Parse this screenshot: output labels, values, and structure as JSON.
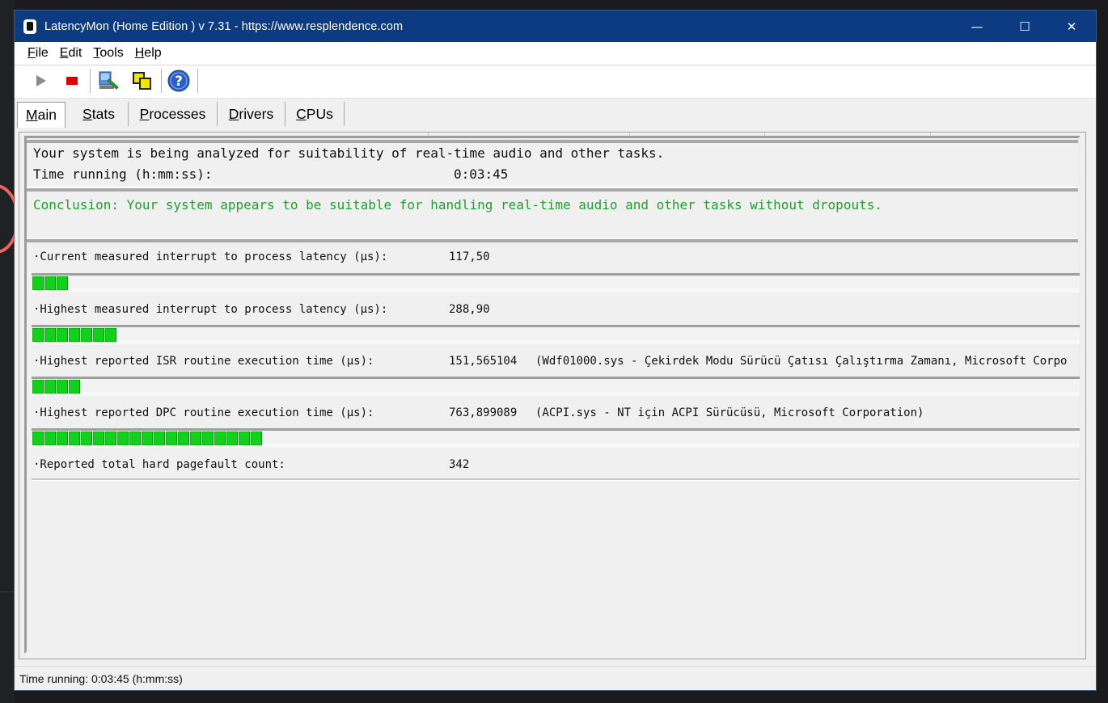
{
  "window": {
    "title": "LatencyMon  (Home Edition )  v 7.31 - https://www.resplendence.com",
    "minimize_glyph": "—",
    "maximize_glyph": "☐",
    "close_glyph": "✕"
  },
  "menu": {
    "items": [
      {
        "first": "F",
        "rest": "ile"
      },
      {
        "first": "E",
        "rest": "dit"
      },
      {
        "first": "T",
        "rest": "ools"
      },
      {
        "first": "H",
        "rest": "elp"
      }
    ]
  },
  "toolbar": {
    "icons": [
      "play-icon",
      "stop-icon",
      "driver-wizard-icon",
      "windows-icon",
      "help-icon"
    ],
    "help_glyph": "?",
    "colors": {
      "stop": "#e00000",
      "play": "#8a8a8a",
      "help": "#2a5fc4"
    }
  },
  "tabs": [
    {
      "first": "M",
      "rest": "ain"
    },
    {
      "first": "S",
      "rest": "tats"
    },
    {
      "first": "P",
      "rest": "rocesses"
    },
    {
      "first": "D",
      "rest": "rivers"
    },
    {
      "first": "C",
      "rest": "PUs"
    }
  ],
  "main": {
    "analysis_text": "Your system is being analyzed for suitability of real-time audio and other tasks.",
    "time_label": "Time running (h:mm:ss):",
    "time_value": "0:03:45",
    "conclusion": "Conclusion: Your system appears to be suitable for handling real-time audio and other tasks without dropouts.",
    "conclusion_color": "#1f9e2e",
    "metrics": [
      {
        "label": "·Current measured interrupt to process latency (µs):",
        "value": "117,50",
        "extra": "",
        "meter_segments": 3
      },
      {
        "label": "·Highest measured interrupt to process latency (µs):",
        "value": "288,90",
        "extra": "",
        "meter_segments": 7
      },
      {
        "label": "·Highest reported ISR routine execution time (µs):",
        "value": "151,565104",
        "extra": "(Wdf01000.sys - Çekirdek Modu Sürücü Çatısı Çalıştırma Zamanı, Microsoft Corpo",
        "meter_segments": 4
      },
      {
        "label": "·Highest reported DPC routine execution time (µs):",
        "value": "763,899089",
        "extra": "(ACPI.sys - NT için ACPI Sürücüsü, Microsoft Corporation)",
        "meter_segments": 19
      },
      {
        "label": "·Reported total hard pagefault count:",
        "value": "342",
        "extra": "",
        "meter_segments": 0
      }
    ],
    "meter_color": "#11d11b"
  },
  "statusbar": {
    "text": "Time running: 0:03:45  (h:mm:ss)"
  }
}
